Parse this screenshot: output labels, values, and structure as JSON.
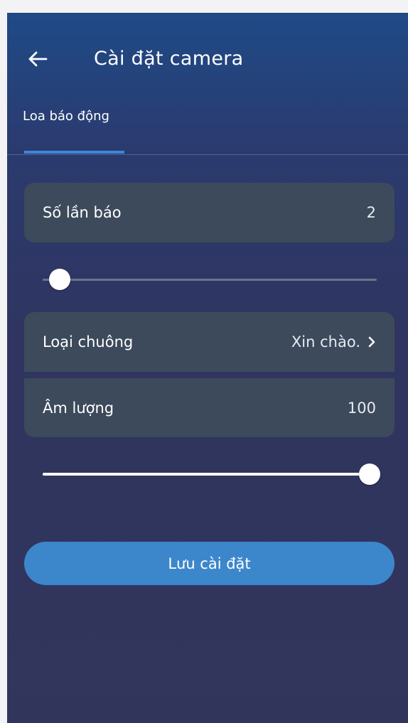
{
  "header": {
    "title": "Cài đặt camera",
    "back_icon": "arrow-left-icon"
  },
  "tabs": [
    {
      "label": "Loa báo động",
      "active": true
    }
  ],
  "alarm_count": {
    "label": "Số lần báo",
    "value": "2",
    "slider_fraction": 0.02
  },
  "ringtone": {
    "label": "Loại chuông",
    "value": "Xin chào.",
    "chevron_icon": "chevron-right-icon"
  },
  "volume": {
    "label": "Âm lượng",
    "value": "100",
    "slider_fraction": 1.0
  },
  "save_button": {
    "label": "Lưu cài đặt"
  },
  "colors": {
    "accent": "#3c86cc",
    "tab_indicator": "#3d87d6",
    "card_bg": "#3c4a5b",
    "background": "#32355b"
  }
}
